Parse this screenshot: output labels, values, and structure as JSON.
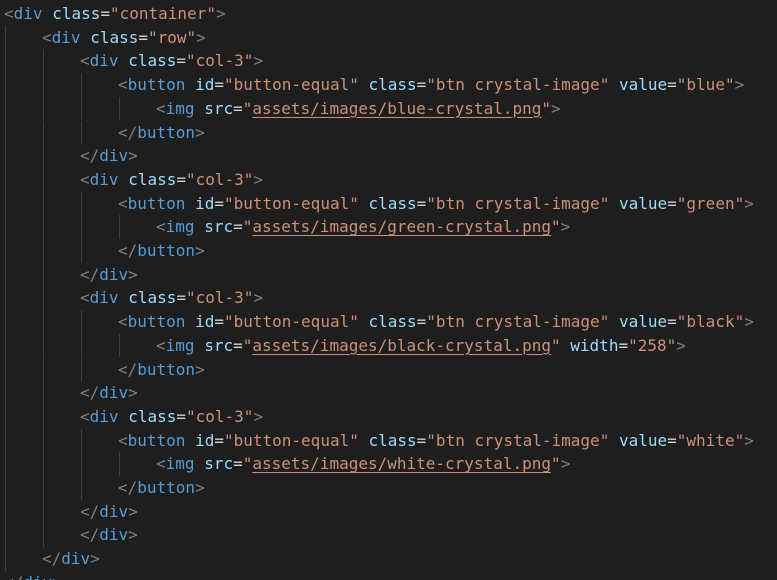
{
  "editor": {
    "theme": {
      "background": "#1e1e1e",
      "punctuation": "#808080",
      "tag": "#569cd6",
      "attribute": "#9cdcfe",
      "string": "#ce9178",
      "text": "#d4d4d4",
      "indent_guide": "#404040"
    },
    "lines": [
      {
        "indent": 0,
        "tokens": [
          [
            "p",
            "<"
          ],
          [
            "t",
            "div"
          ],
          [
            "o",
            " "
          ],
          [
            "a",
            "class"
          ],
          [
            "o",
            "="
          ],
          [
            "v",
            "\"container\""
          ],
          [
            "p",
            ">"
          ]
        ]
      },
      {
        "indent": 1,
        "tokens": [
          [
            "p",
            "<"
          ],
          [
            "t",
            "div"
          ],
          [
            "o",
            " "
          ],
          [
            "a",
            "class"
          ],
          [
            "o",
            "="
          ],
          [
            "v",
            "\"row\""
          ],
          [
            "p",
            ">"
          ]
        ]
      },
      {
        "indent": 2,
        "tokens": [
          [
            "p",
            "<"
          ],
          [
            "t",
            "div"
          ],
          [
            "o",
            " "
          ],
          [
            "a",
            "class"
          ],
          [
            "o",
            "="
          ],
          [
            "v",
            "\"col-3\""
          ],
          [
            "p",
            ">"
          ]
        ]
      },
      {
        "indent": 3,
        "tokens": [
          [
            "p",
            "<"
          ],
          [
            "t",
            "button"
          ],
          [
            "o",
            " "
          ],
          [
            "a",
            "id"
          ],
          [
            "o",
            "="
          ],
          [
            "v",
            "\"button-equal\""
          ],
          [
            "o",
            " "
          ],
          [
            "a",
            "class"
          ],
          [
            "o",
            "="
          ],
          [
            "v",
            "\"btn crystal-image\""
          ],
          [
            "o",
            " "
          ],
          [
            "a",
            "value"
          ],
          [
            "o",
            "="
          ],
          [
            "v",
            "\"blue\""
          ],
          [
            "p",
            ">"
          ]
        ]
      },
      {
        "indent": 4,
        "tokens": [
          [
            "p",
            "<"
          ],
          [
            "t",
            "img"
          ],
          [
            "o",
            " "
          ],
          [
            "a",
            "src"
          ],
          [
            "o",
            "="
          ],
          [
            "v",
            "\""
          ],
          [
            "u",
            "assets/images/blue-crystal.png"
          ],
          [
            "v",
            "\""
          ],
          [
            "p",
            ">"
          ]
        ]
      },
      {
        "indent": 3,
        "tokens": [
          [
            "p",
            "</"
          ],
          [
            "t",
            "button"
          ],
          [
            "p",
            ">"
          ]
        ]
      },
      {
        "indent": 2,
        "tokens": [
          [
            "p",
            "</"
          ],
          [
            "t",
            "div"
          ],
          [
            "p",
            ">"
          ]
        ]
      },
      {
        "indent": 2,
        "tokens": [
          [
            "p",
            "<"
          ],
          [
            "t",
            "div"
          ],
          [
            "o",
            " "
          ],
          [
            "a",
            "class"
          ],
          [
            "o",
            "="
          ],
          [
            "v",
            "\"col-3\""
          ],
          [
            "p",
            ">"
          ]
        ]
      },
      {
        "indent": 3,
        "tokens": [
          [
            "p",
            "<"
          ],
          [
            "t",
            "button"
          ],
          [
            "o",
            " "
          ],
          [
            "a",
            "id"
          ],
          [
            "o",
            "="
          ],
          [
            "v",
            "\"button-equal\""
          ],
          [
            "o",
            " "
          ],
          [
            "a",
            "class"
          ],
          [
            "o",
            "="
          ],
          [
            "v",
            "\"btn crystal-image\""
          ],
          [
            "o",
            " "
          ],
          [
            "a",
            "value"
          ],
          [
            "o",
            "="
          ],
          [
            "v",
            "\"green\""
          ],
          [
            "p",
            ">"
          ]
        ]
      },
      {
        "indent": 4,
        "tokens": [
          [
            "p",
            "<"
          ],
          [
            "t",
            "img"
          ],
          [
            "o",
            " "
          ],
          [
            "a",
            "src"
          ],
          [
            "o",
            "="
          ],
          [
            "v",
            "\""
          ],
          [
            "u",
            "assets/images/green-crystal.png"
          ],
          [
            "v",
            "\""
          ],
          [
            "p",
            ">"
          ]
        ]
      },
      {
        "indent": 3,
        "tokens": [
          [
            "p",
            "</"
          ],
          [
            "t",
            "button"
          ],
          [
            "p",
            ">"
          ]
        ]
      },
      {
        "indent": 2,
        "tokens": [
          [
            "p",
            "</"
          ],
          [
            "t",
            "div"
          ],
          [
            "p",
            ">"
          ]
        ]
      },
      {
        "indent": 2,
        "tokens": [
          [
            "p",
            "<"
          ],
          [
            "t",
            "div"
          ],
          [
            "o",
            " "
          ],
          [
            "a",
            "class"
          ],
          [
            "o",
            "="
          ],
          [
            "v",
            "\"col-3\""
          ],
          [
            "p",
            ">"
          ]
        ]
      },
      {
        "indent": 3,
        "tokens": [
          [
            "p",
            "<"
          ],
          [
            "t",
            "button"
          ],
          [
            "o",
            " "
          ],
          [
            "a",
            "id"
          ],
          [
            "o",
            "="
          ],
          [
            "v",
            "\"button-equal\""
          ],
          [
            "o",
            " "
          ],
          [
            "a",
            "class"
          ],
          [
            "o",
            "="
          ],
          [
            "v",
            "\"btn crystal-image\""
          ],
          [
            "o",
            " "
          ],
          [
            "a",
            "value"
          ],
          [
            "o",
            "="
          ],
          [
            "v",
            "\"black\""
          ],
          [
            "p",
            ">"
          ]
        ]
      },
      {
        "indent": 4,
        "tokens": [
          [
            "p",
            "<"
          ],
          [
            "t",
            "img"
          ],
          [
            "o",
            " "
          ],
          [
            "a",
            "src"
          ],
          [
            "o",
            "="
          ],
          [
            "v",
            "\""
          ],
          [
            "u",
            "assets/images/black-crystal.png"
          ],
          [
            "v",
            "\""
          ],
          [
            "o",
            " "
          ],
          [
            "a",
            "width"
          ],
          [
            "o",
            "="
          ],
          [
            "v",
            "\"258\""
          ],
          [
            "p",
            ">"
          ]
        ]
      },
      {
        "indent": 3,
        "tokens": [
          [
            "p",
            "</"
          ],
          [
            "t",
            "button"
          ],
          [
            "p",
            ">"
          ]
        ]
      },
      {
        "indent": 2,
        "tokens": [
          [
            "p",
            "</"
          ],
          [
            "t",
            "div"
          ],
          [
            "p",
            ">"
          ]
        ]
      },
      {
        "indent": 2,
        "tokens": [
          [
            "p",
            "<"
          ],
          [
            "t",
            "div"
          ],
          [
            "o",
            " "
          ],
          [
            "a",
            "class"
          ],
          [
            "o",
            "="
          ],
          [
            "v",
            "\"col-3\""
          ],
          [
            "p",
            ">"
          ]
        ]
      },
      {
        "indent": 3,
        "tokens": [
          [
            "p",
            "<"
          ],
          [
            "t",
            "button"
          ],
          [
            "o",
            " "
          ],
          [
            "a",
            "id"
          ],
          [
            "o",
            "="
          ],
          [
            "v",
            "\"button-equal\""
          ],
          [
            "o",
            " "
          ],
          [
            "a",
            "class"
          ],
          [
            "o",
            "="
          ],
          [
            "v",
            "\"btn crystal-image\""
          ],
          [
            "o",
            " "
          ],
          [
            "a",
            "value"
          ],
          [
            "o",
            "="
          ],
          [
            "v",
            "\"white\""
          ],
          [
            "p",
            ">"
          ]
        ]
      },
      {
        "indent": 4,
        "tokens": [
          [
            "p",
            "<"
          ],
          [
            "t",
            "img"
          ],
          [
            "o",
            " "
          ],
          [
            "a",
            "src"
          ],
          [
            "o",
            "="
          ],
          [
            "v",
            "\""
          ],
          [
            "u",
            "assets/images/white-crystal.png"
          ],
          [
            "v",
            "\""
          ],
          [
            "p",
            ">"
          ]
        ]
      },
      {
        "indent": 3,
        "tokens": [
          [
            "p",
            "</"
          ],
          [
            "t",
            "button"
          ],
          [
            "p",
            ">"
          ]
        ]
      },
      {
        "indent": 2,
        "tokens": [
          [
            "p",
            "</"
          ],
          [
            "t",
            "div"
          ],
          [
            "p",
            ">"
          ]
        ]
      },
      {
        "indent": 2,
        "tokens": [
          [
            "p",
            "</"
          ],
          [
            "t",
            "div"
          ],
          [
            "p",
            ">"
          ]
        ]
      },
      {
        "indent": 1,
        "tokens": [
          [
            "p",
            "</"
          ],
          [
            "t",
            "div"
          ],
          [
            "p",
            ">"
          ]
        ]
      },
      {
        "indent": 0,
        "tokens": [
          [
            "p",
            "</"
          ],
          [
            "t",
            "div"
          ],
          [
            "p",
            ">"
          ]
        ]
      }
    ]
  }
}
